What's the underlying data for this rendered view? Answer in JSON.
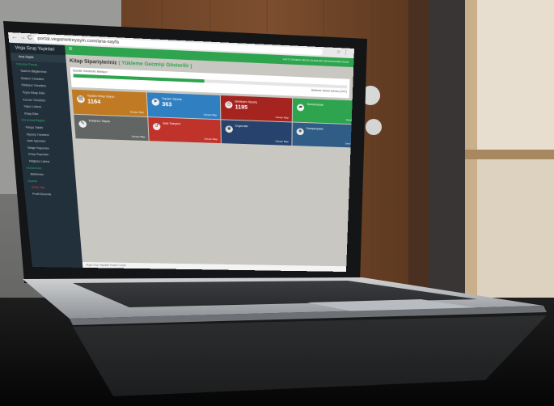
{
  "colors": {
    "accent": "#2ea44f",
    "sidebar": "#22303b",
    "tile_orange": "#c07a23",
    "tile_blue": "#2f7fc1",
    "tile_darkred": "#a5241f",
    "tile_green": "#2ea44f",
    "tile_gray": "#616665",
    "tile_red": "#c0332b",
    "tile_navy": "#27436d",
    "tile_steel": "#2f5d85"
  },
  "browser": {
    "url": "portal.vegametreyayin.com/ana-sayfa"
  },
  "app": {
    "brand": "Vega Grup Yayinlari",
    "topbar_right": "KAYIT DONEMI GECIS ISLEMLERI DEVAM ETMEKTEDIR",
    "page_title": "Kitap Siparişleriniz",
    "page_title_accent": "( Yükleme Gecmişi Gösterilir )",
    "progress_label": "Bundle Gönderim Bekliyor",
    "progress_value": 0.47,
    "progress_right": "Bekleme Süresi Sonrası (%47)",
    "footer": "Vega Grup Yayinlari Portal © 2022"
  },
  "sidebar": {
    "items": [
      {
        "label": "Ana Sayfa",
        "type": "active"
      },
      {
        "label": "Yönetim Paneli",
        "type": "head"
      },
      {
        "label": "Yazılım Bilgilerimiz",
        "type": "item"
      },
      {
        "label": "Sistem Yönetimi",
        "type": "item"
      },
      {
        "label": "Kitabevi Yönetimi",
        "type": "item"
      },
      {
        "label": "Toplu Kitap Ekle",
        "type": "item"
      },
      {
        "label": "Kurum Yönetimi",
        "type": "item"
      },
      {
        "label": "Yayın Listesi",
        "type": "item"
      },
      {
        "label": "Kitap Ekle",
        "type": "item"
      },
      {
        "label": "Kurumsal Bilgiler",
        "type": "head"
      },
      {
        "label": "Kargo Takibi",
        "type": "item"
      },
      {
        "label": "Sipariş Yönetimi",
        "type": "item"
      },
      {
        "label": "İade İşlemleri",
        "type": "item"
      },
      {
        "label": "Bölge Raporları",
        "type": "item"
      },
      {
        "label": "Kitap Raporları",
        "type": "item"
      },
      {
        "label": "Mağaza Listesi",
        "type": "item"
      },
      {
        "label": "Kullanıcılar",
        "type": "head"
      },
      {
        "label": "Bildirimler",
        "type": "item"
      },
      {
        "label": "Ayarlar",
        "type": "head"
      },
      {
        "label": "Çıkış Yap",
        "type": "danger"
      },
      {
        "label": "Profil Düzenle",
        "type": "item"
      }
    ]
  },
  "tiles": [
    {
      "title": "Toplam Kitap Sayısı",
      "value": "1164",
      "detail": "Detaylı Bilgi",
      "icon": "book-icon",
      "color": "#c07a23"
    },
    {
      "title": "Toplam Sipariş",
      "value": "363",
      "detail": "Detaylı Bilgi",
      "icon": "send-icon",
      "color": "#2f7fc1"
    },
    {
      "title": "Bekleyen Sipariş",
      "value": "1195",
      "detail": "Detaylı Bilgi",
      "icon": "clock-icon",
      "color": "#a5241f"
    },
    {
      "title": "Tamamlanan",
      "value": "",
      "detail": "Detaylı Bilgi",
      "icon": "truck-icon",
      "color": "#2ea44f"
    },
    {
      "title": "Kullanıcı Sayısı",
      "value": "",
      "detail": "Detaylı Bilgi",
      "icon": "edit-icon",
      "color": "#616665"
    },
    {
      "title": "İade Talepleri",
      "value": "",
      "detail": "Detaylı Bilgi",
      "icon": "return-icon",
      "color": "#c0332b"
    },
    {
      "title": "Duyurular",
      "value": "",
      "detail": "Detaylı Bilgi",
      "icon": "megaphone-icon",
      "color": "#27436d"
    },
    {
      "title": "Kampanyalar",
      "value": "",
      "detail": "Detaylı Bilgi",
      "icon": "tag-icon",
      "color": "#2f5d85"
    }
  ]
}
